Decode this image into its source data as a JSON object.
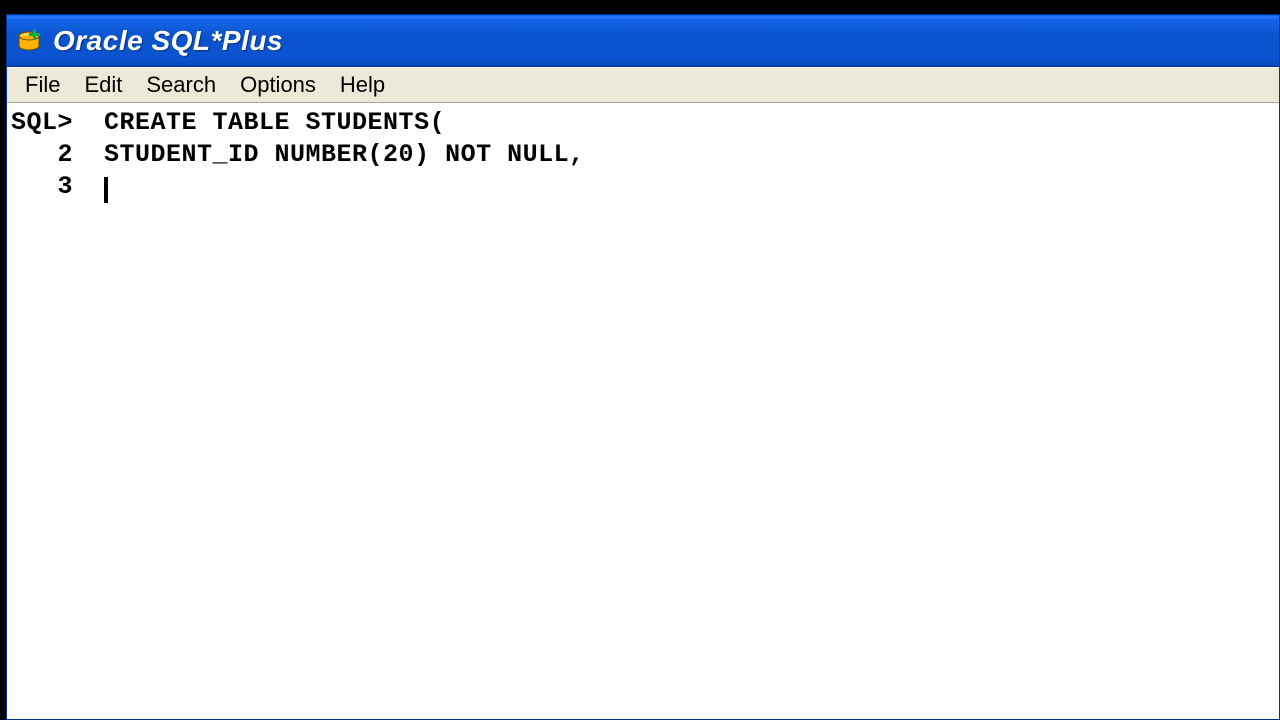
{
  "window": {
    "title": "Oracle SQL*Plus"
  },
  "menubar": {
    "items": [
      {
        "label": "File"
      },
      {
        "label": "Edit"
      },
      {
        "label": "Search"
      },
      {
        "label": "Options"
      },
      {
        "label": "Help"
      }
    ]
  },
  "terminal": {
    "lines": [
      {
        "prompt": "SQL>",
        "num": "",
        "text": "CREATE TABLE STUDENTS("
      },
      {
        "prompt": "",
        "num": "2",
        "text": "STUDENT_ID NUMBER(20) NOT NULL,"
      },
      {
        "prompt": "",
        "num": "3",
        "text": "",
        "cursor": true
      }
    ]
  },
  "icons": {
    "app": "database-plus-icon"
  }
}
